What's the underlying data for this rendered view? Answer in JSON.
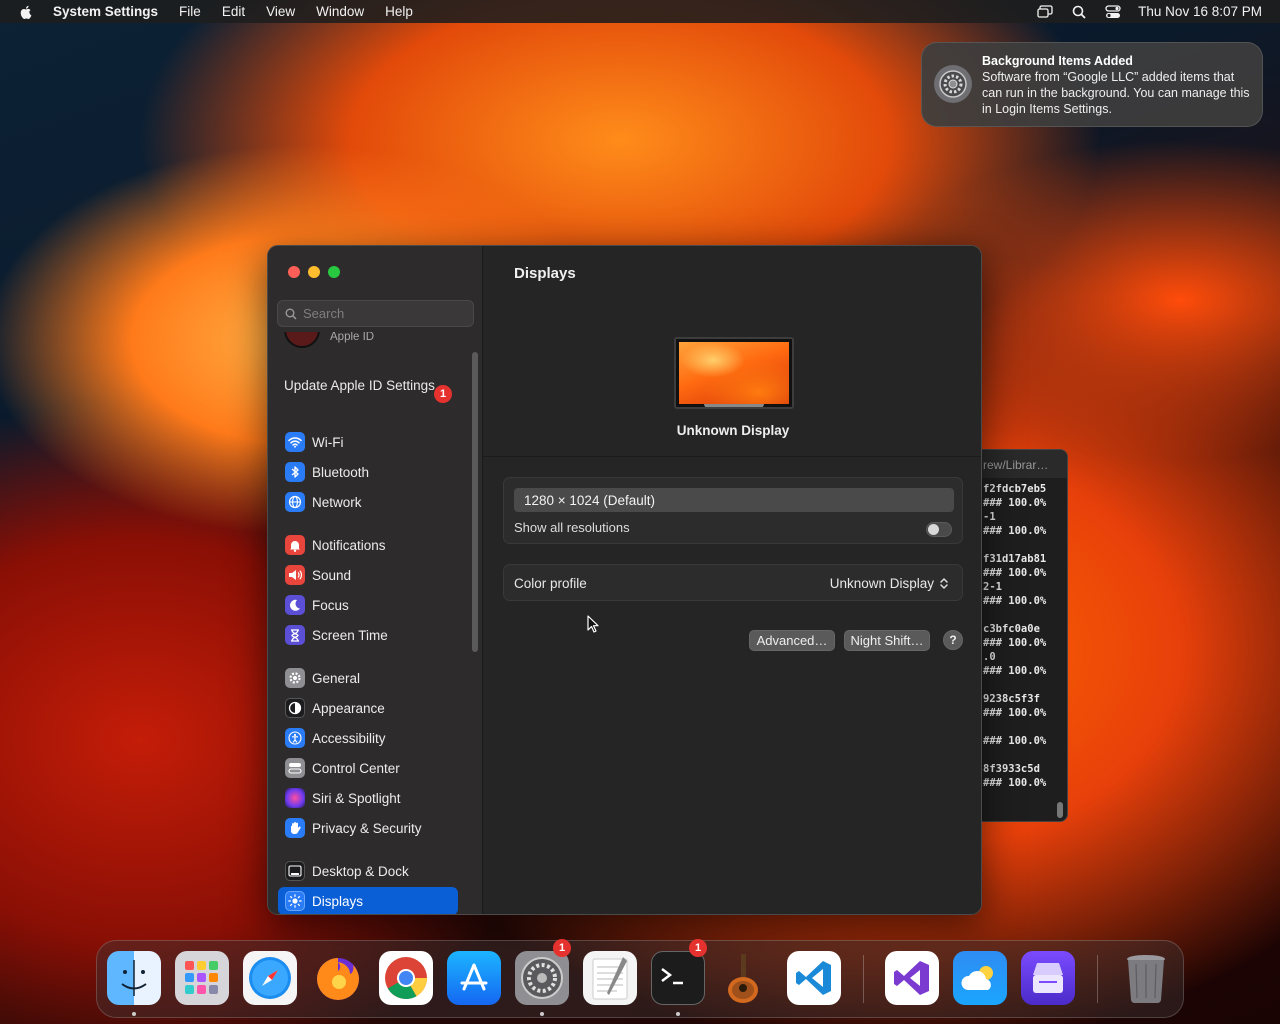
{
  "menubar": {
    "app_name": "System Settings",
    "menus": [
      "File",
      "Edit",
      "View",
      "Window",
      "Help"
    ],
    "clock": "Thu Nov 16  8:07 PM"
  },
  "notification": {
    "title": "Background Items Added",
    "body": "Software from “Google LLC” added items that can run in the background. You can manage this in Login Items Settings."
  },
  "terminal": {
    "title": "rew/Librar…",
    "lines": "f2fdcb7eb5\n### 100.0%\n-1\n### 100.0%\n\nf31d17ab81\n### 100.0%\n2-1\n### 100.0%\n\nc3bfc0a0e\n### 100.0%\n.0\n### 100.0%\n\n9238c5f3f\n### 100.0%\n\n### 100.0%\n\n8f3933c5d\n### 100.0%"
  },
  "settings": {
    "search_placeholder": "Search",
    "apple_id_sub": "Apple ID",
    "update_label": "Update Apple ID Settings",
    "update_badge": "1",
    "sidebar_items": [
      {
        "label": "Wi-Fi",
        "icon": "wifi-icon",
        "color": "#2a7cf6"
      },
      {
        "label": "Bluetooth",
        "icon": "bluetooth-icon",
        "color": "#2a7cf6"
      },
      {
        "label": "Network",
        "icon": "globe-icon",
        "color": "#2a7cf6"
      },
      {
        "label": "Notifications",
        "icon": "bell-icon",
        "color": "#e8453c"
      },
      {
        "label": "Sound",
        "icon": "speaker-icon",
        "color": "#e8453c"
      },
      {
        "label": "Focus",
        "icon": "moon-icon",
        "color": "#5b4fd6"
      },
      {
        "label": "Screen Time",
        "icon": "hourglass-icon",
        "color": "#5b4fd6"
      },
      {
        "label": "General",
        "icon": "gear-icon",
        "color": "#8e8e93"
      },
      {
        "label": "Appearance",
        "icon": "appearance-icon",
        "color": "#1c1c1e"
      },
      {
        "label": "Accessibility",
        "icon": "accessibility-icon",
        "color": "#2a7cf6"
      },
      {
        "label": "Control Center",
        "icon": "control-center-icon",
        "color": "#8e8e93"
      },
      {
        "label": "Siri & Spotlight",
        "icon": "siri-icon",
        "color": "#b03cc8"
      },
      {
        "label": "Privacy & Security",
        "icon": "hand-icon",
        "color": "#2a7cf6"
      },
      {
        "label": "Desktop & Dock",
        "icon": "dock-icon",
        "color": "#1c1c1e"
      },
      {
        "label": "Displays",
        "icon": "sun-icon",
        "color": "#2a7cf6"
      }
    ],
    "selected": "Displays",
    "page_title": "Displays",
    "display_name": "Unknown Display",
    "resolution": "1280 × 1024 (Default)",
    "show_all_label": "Show all resolutions",
    "show_all_on": false,
    "color_profile_label": "Color profile",
    "color_profile_value": "Unknown Display",
    "advanced_label": "Advanced…",
    "night_shift_label": "Night Shift…",
    "help_label": "?"
  },
  "dock": {
    "apps": [
      {
        "name": "Finder",
        "icon": "finder-icon",
        "running": true
      },
      {
        "name": "Launchpad",
        "icon": "launchpad-icon",
        "running": false
      },
      {
        "name": "Safari",
        "icon": "safari-icon",
        "running": false
      },
      {
        "name": "Firefox",
        "icon": "firefox-icon",
        "running": false
      },
      {
        "name": "Chrome",
        "icon": "chrome-icon",
        "running": false
      },
      {
        "name": "App Store",
        "icon": "app-store-icon",
        "running": false
      },
      {
        "name": "System Settings",
        "icon": "system-settings-icon",
        "running": true,
        "badge": "1"
      },
      {
        "name": "TextEdit",
        "icon": "textedit-icon",
        "running": false
      },
      {
        "name": "Terminal",
        "icon": "terminal-icon",
        "running": true,
        "badge": "1"
      },
      {
        "name": "GarageBand",
        "icon": "garageband-icon",
        "running": false
      },
      {
        "name": "Visual Studio Code",
        "icon": "vscode-icon",
        "running": false
      },
      {
        "name": "Visual Studio",
        "icon": "visual-studio-icon",
        "running": false
      },
      {
        "name": "Weather",
        "icon": "weather-icon",
        "running": false
      },
      {
        "name": "Archive",
        "icon": "archive-icon",
        "running": false
      },
      {
        "name": "Trash",
        "icon": "trash-icon",
        "running": false
      }
    ]
  }
}
